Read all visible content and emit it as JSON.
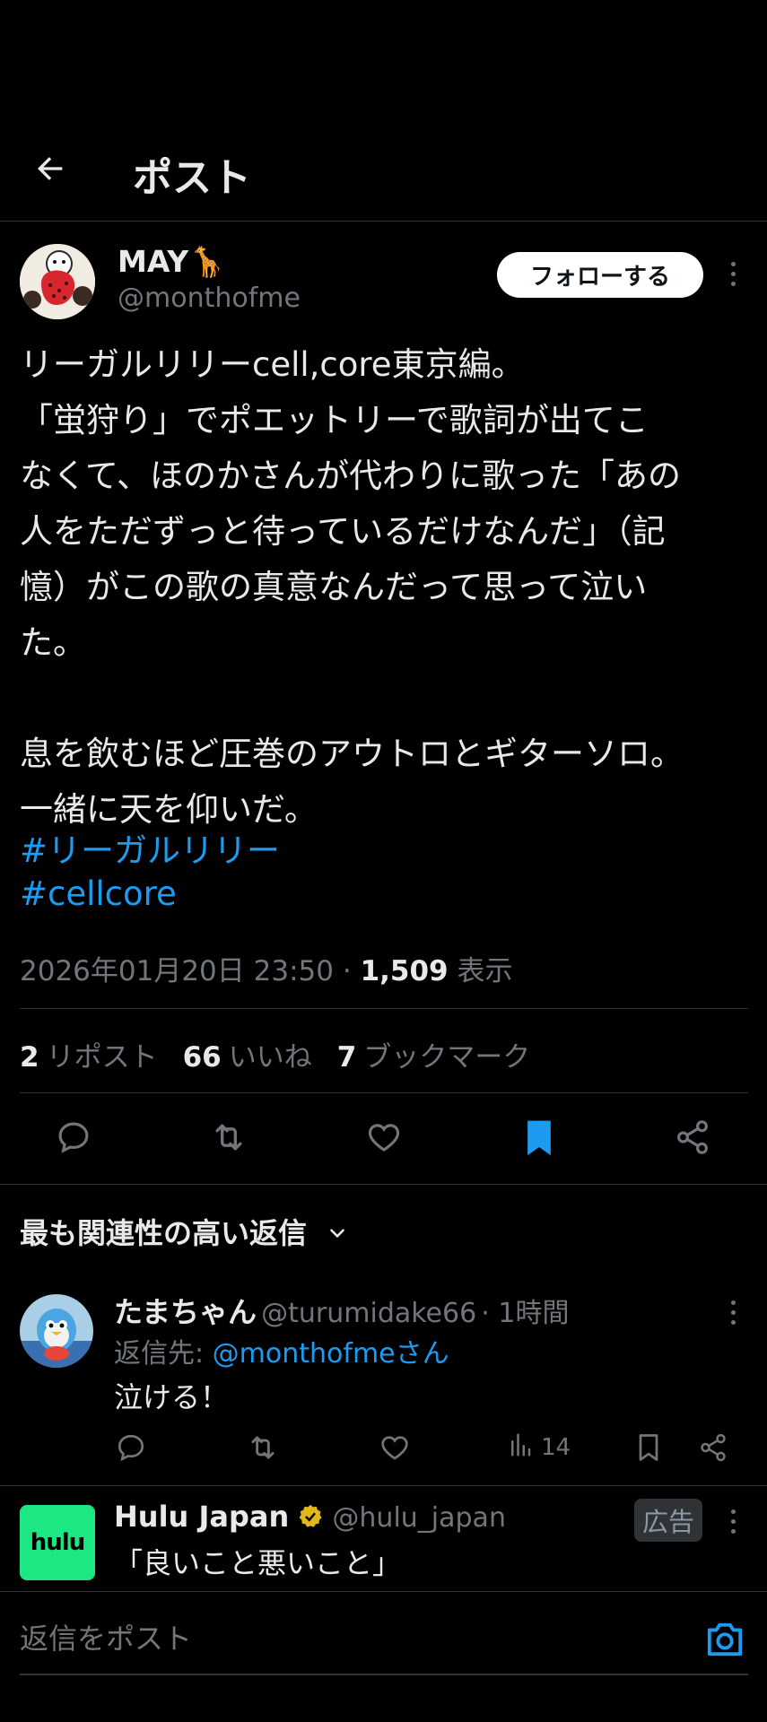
{
  "header": {
    "title": "ポスト"
  },
  "author": {
    "name": "MAY🦒",
    "handle": "@monthofme",
    "follow_label": "フォローする"
  },
  "post": {
    "text": "リーガルリリーcell,core東京編。\n「蛍狩り」でポエットリーで歌詞が出てこ\nなくて、ほのかさんが代わりに歌った「あの\n人をただずっと待っているだけなんだ」（記\n憶）がこの歌の真意なんだって思って泣い\nた。\n\n息を飲むほど圧巻のアウトロとギターソロ。\n一緒に天を仰いだ。",
    "hashtags": [
      "#リーガルリリー",
      "#cellcore"
    ],
    "datetime": "2026年01月20日 23:50",
    "separator": "·",
    "views": "1,509",
    "views_label": "表示"
  },
  "stats": {
    "reposts": "2",
    "reposts_label": "リポスト",
    "likes": "66",
    "likes_label": "いいね",
    "bookmarks": "7",
    "bookmarks_label": "ブックマーク"
  },
  "sort": {
    "label": "最も関連性の高い返信"
  },
  "reply": {
    "name": "たまちゃん",
    "handle": "@turumidake66",
    "time": "· 1時間",
    "reply_to_prefix": "返信先: ",
    "reply_to": "@monthofmeさん",
    "text": "泣ける！",
    "views": "14"
  },
  "ad": {
    "name": "Hulu Japan",
    "handle": "@hulu_japan",
    "badge": "広告",
    "logo": "hulu",
    "text": "「良いこと悪いこと」"
  },
  "compose": {
    "placeholder": "返信をポスト"
  },
  "colors": {
    "accent": "#1d9bf0",
    "verified": "#e2b719",
    "background": "#000000"
  },
  "icons": [
    "back-arrow-icon",
    "more-icon",
    "reply-icon",
    "repost-icon",
    "like-icon",
    "bookmark-filled-icon",
    "share-icon",
    "chevron-down-icon",
    "views-icon",
    "bookmark-icon",
    "verified-icon",
    "camera-icon"
  ]
}
